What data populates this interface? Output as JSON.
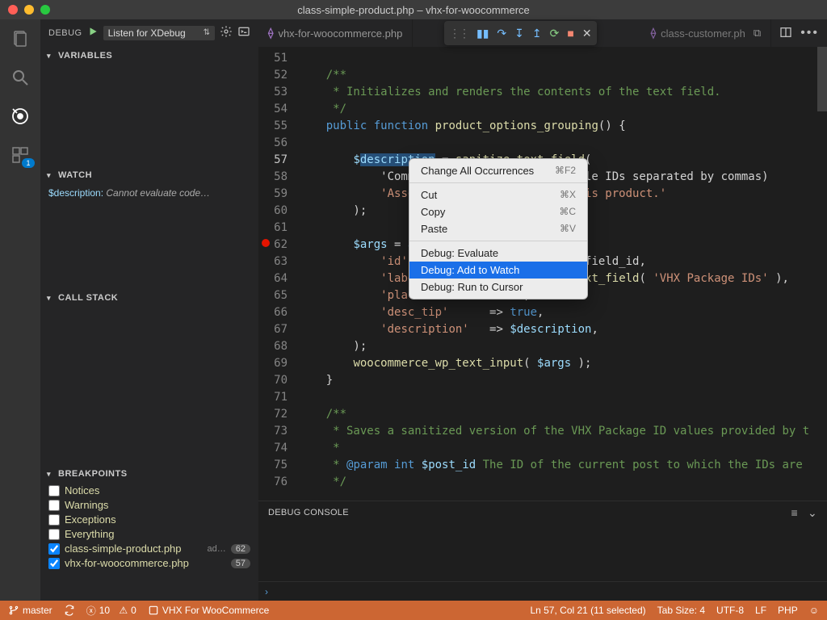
{
  "titlebar": {
    "title": "class-simple-product.php – vhx-for-woocommerce"
  },
  "activity": {
    "badge": "1"
  },
  "debugBar": {
    "label": "DEBUG",
    "config": "Listen for XDebug"
  },
  "sections": {
    "variables": "VARIABLES",
    "watch": "WATCH",
    "callstack": "CALL STACK",
    "breakpoints": "BREAKPOINTS"
  },
  "watch": {
    "expr": "$description:",
    "err": "Cannot evaluate code…"
  },
  "breakpoints": {
    "items": [
      {
        "label": "Notices",
        "checked": false
      },
      {
        "label": "Warnings",
        "checked": false
      },
      {
        "label": "Exceptions",
        "checked": false
      },
      {
        "label": "Everything",
        "checked": false
      }
    ],
    "files": [
      {
        "label": "class-simple-product.php",
        "extra": "ad…",
        "count": "62",
        "checked": true
      },
      {
        "label": "vhx-for-woocommerce.php",
        "extra": "",
        "count": "57",
        "checked": true
      }
    ]
  },
  "tabs": {
    "items": [
      {
        "label": "vhx-for-woocommerce.php"
      },
      {
        "label": "class-customer.ph"
      }
    ]
  },
  "editor": {
    "startLine": 51,
    "currentLine": 57,
    "breakpointLine": 62,
    "lines": [
      "",
      "    /**",
      "     * Initializes and renders the contents of the text field.",
      "     */",
      "    public function product_options_grouping() {",
      "",
      "        $description = sanitize_text_field(",
      "            'Comma-delimited list. (multiple IDs separated by commas)",
      "            'Associate a purchaser with this product.'",
      "        );",
      "",
      "        $args = array(",
      "            'id'            => $this->textfield_id,",
      "            'label'         => sanitize_text_field( 'VHX Package IDs' ),",
      "            'placeholder'   => '',",
      "            'desc_tip'      => true,",
      "            'description'   => $description,",
      "        );",
      "        woocommerce_wp_text_input( $args );",
      "    }",
      "",
      "    /**",
      "     * Saves a sanitized version of the VHX Package ID values provided by t",
      "     *",
      "     * @param int $post_id The ID of the current post to which the IDs are",
      "     */"
    ]
  },
  "contextMenu": {
    "items": [
      {
        "label": "Change All Occurrences",
        "shortcut": "⌘F2"
      },
      {
        "sep": true
      },
      {
        "label": "Cut",
        "shortcut": "⌘X"
      },
      {
        "label": "Copy",
        "shortcut": "⌘C"
      },
      {
        "label": "Paste",
        "shortcut": "⌘V"
      },
      {
        "sep": true
      },
      {
        "label": "Debug: Evaluate",
        "shortcut": ""
      },
      {
        "label": "Debug: Add to Watch",
        "shortcut": "",
        "hl": true
      },
      {
        "label": "Debug: Run to Cursor",
        "shortcut": ""
      }
    ]
  },
  "panel": {
    "title": "DEBUG CONSOLE"
  },
  "status": {
    "branch": "master",
    "sync": "",
    "errors": "0",
    "warnings": "0",
    "x": "10",
    "project": "VHX For WooCommerce",
    "cursor": "Ln 57, Col 21 (11 selected)",
    "tabsize": "Tab Size: 4",
    "encoding": "UTF-8",
    "eol": "LF",
    "lang": "PHP"
  }
}
